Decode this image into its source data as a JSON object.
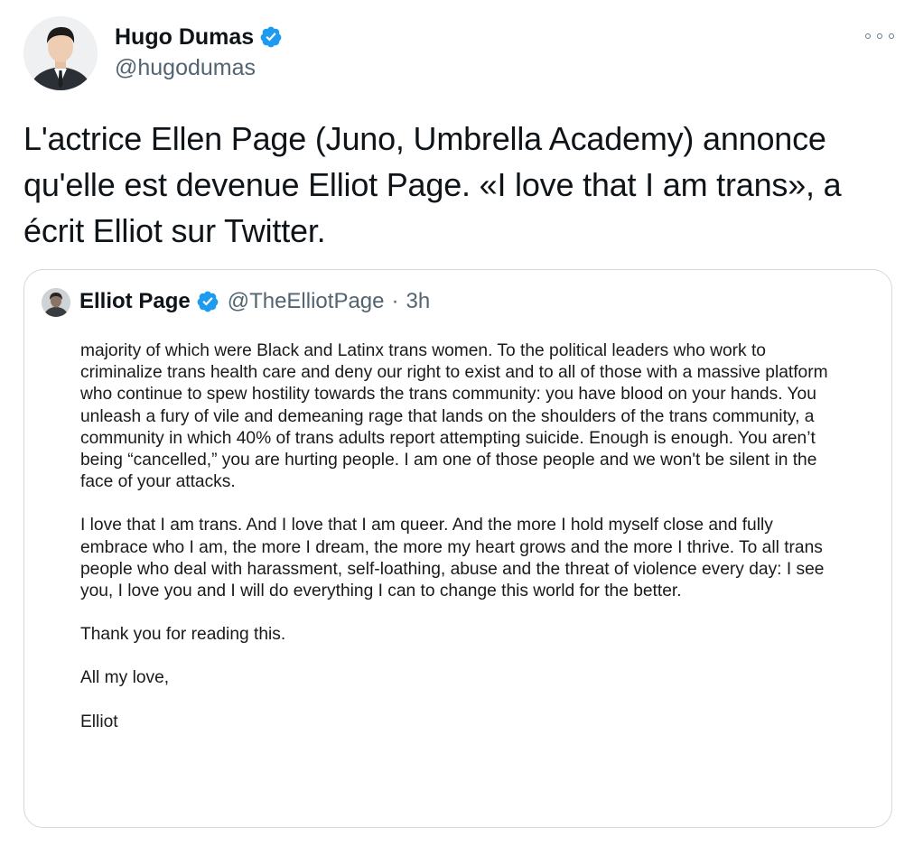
{
  "tweet": {
    "author_name": "Hugo Dumas",
    "author_handle": "@hugodumas",
    "more_icon": "more-horizontal-icon",
    "text": "L'actrice Ellen Page (Juno, Umbrella Academy) annonce qu'elle est devenue Elliot Page. «I love that I am trans», a écrit Elliot sur Twitter.",
    "verified_icon": "verified-badge-icon"
  },
  "quote": {
    "author_name": "Elliot Page",
    "author_handle": "@TheElliotPage",
    "separator": "·",
    "time": "3h",
    "letter_paragraphs": [
      "majority of which were Black and Latinx trans women. To the political leaders who work to criminalize trans health care and deny our right to exist and to all of those with a massive platform who continue to spew hostility towards the trans community: you have blood on your hands. You unleash a fury of vile and demeaning rage that lands on the shoulders of the trans community, a community in which 40% of trans adults report attempting suicide. Enough is enough. You aren’t being “cancelled,” you are hurting people. I am one of those people and we won't be silent in the face of your attacks.",
      "I love that I am trans. And I love that I am queer. And the more I hold myself close and fully embrace who I am, the more I dream, the more my heart grows and the more I thrive. To all trans people who deal with harassment, self-loathing, abuse and the threat of violence every day: I see you, I love you and I will do everything I can to change this world for the better.",
      "Thank you for reading this.",
      "All my love,",
      "Elliot"
    ]
  },
  "colors": {
    "verified_blue": "#1d9bf0",
    "secondary_text": "#536471",
    "border": "#cfd9de"
  }
}
